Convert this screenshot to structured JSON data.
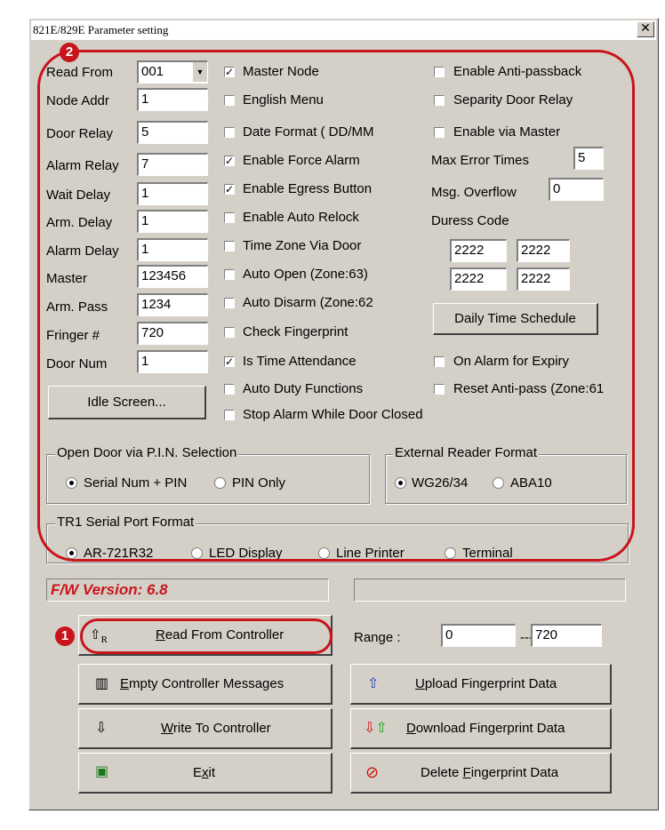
{
  "window": {
    "title": "821E/829E Parameter setting",
    "close_glyph": "✕"
  },
  "fields": [
    {
      "label": "Read From",
      "value": "001"
    },
    {
      "label": "Node Addr",
      "value": "1"
    },
    {
      "label": "Door Relay",
      "value": "5"
    },
    {
      "label": "Alarm Relay",
      "value": "7"
    },
    {
      "label": "Wait Delay",
      "value": "1"
    },
    {
      "label": "Arm. Delay",
      "value": "1"
    },
    {
      "label": "Alarm Delay",
      "value": "1"
    },
    {
      "label": "Master",
      "value": "123456"
    },
    {
      "label": "Arm. Pass",
      "value": "1234"
    },
    {
      "label": "Fringer #",
      "value": "720"
    },
    {
      "label": "Door Num",
      "value": "1"
    }
  ],
  "middle_checks": [
    {
      "label": "Master Node",
      "checked": true
    },
    {
      "label": "English Menu",
      "checked": false
    },
    {
      "label": "Date Format ( DD/MM",
      "checked": false
    },
    {
      "label": "Enable Force Alarm",
      "checked": true
    },
    {
      "label": "Enable Egress Button",
      "checked": true
    },
    {
      "label": "Enable Auto Relock",
      "checked": false
    },
    {
      "label": "Time Zone Via Door",
      "checked": false
    },
    {
      "label": "Auto Open (Zone:63)",
      "checked": false
    },
    {
      "label": "Auto Disarm (Zone:62",
      "checked": false
    },
    {
      "label": "Check Fingerprint",
      "checked": false
    },
    {
      "label": "Is Time Attendance",
      "checked": true
    },
    {
      "label": "Auto Duty Functions",
      "checked": false
    },
    {
      "label": "Stop Alarm While Door Closed",
      "checked": false
    }
  ],
  "right_checks": [
    {
      "label": "Enable Anti-passback",
      "checked": false
    },
    {
      "label": "Separity Door Relay",
      "checked": false
    },
    {
      "label": "Enable via Master",
      "checked": false
    }
  ],
  "max_error": {
    "label": "Max Error Times",
    "value": "5"
  },
  "msg_overflow": {
    "label": "Msg. Overflow",
    "value": "0"
  },
  "duress": {
    "label": "Duress Code",
    "codes": [
      "2222",
      "2222",
      "2222",
      "2222"
    ]
  },
  "daily_schedule_label": "Daily Time Schedule",
  "expiry_check": {
    "label": "On Alarm for Expiry",
    "checked": false
  },
  "reset_check": {
    "label": "Reset Anti-pass (Zone:61",
    "checked": false
  },
  "idle_button": "Idle Screen...",
  "pin_group": {
    "title": "Open Door via P.I.N. Selection",
    "options": [
      "Serial Num + PIN",
      "PIN Only"
    ],
    "selected": 0
  },
  "reader_group": {
    "title": "External Reader Format",
    "options": [
      "WG26/34",
      "ABA10"
    ],
    "selected": 0
  },
  "serial_group": {
    "title": "TR1 Serial Port Format",
    "options": [
      "AR-721R32",
      "LED Display",
      "Line Printer",
      "Terminal"
    ],
    "selected": 0
  },
  "fw_version": "F/W Version: 6.8",
  "range": {
    "label": "Range :",
    "from": "0",
    "sep": "---",
    "to": "720"
  },
  "buttons": {
    "read": {
      "pre": "",
      "ul": "R",
      "post": "ead From Controller"
    },
    "empty": {
      "pre": "",
      "ul": "E",
      "post": "mpty Controller Messages"
    },
    "write": {
      "pre": "",
      "ul": "W",
      "post": "rite To Controller"
    },
    "exit": {
      "pre": "E",
      "ul": "x",
      "post": "it"
    },
    "upload": {
      "pre": "",
      "ul": "U",
      "post": "pload Fingerprint Data"
    },
    "download": {
      "pre": "",
      "ul": "D",
      "post": "ownload Fingerprint Data"
    },
    "delete": {
      "pre": "Delete ",
      "ul": "F",
      "post": "ingerprint Data"
    }
  },
  "annotations": {
    "badge1": "1",
    "badge2": "2",
    "accent": "#c8151b"
  },
  "colors": {
    "dialog_bg": "#d4d0c8",
    "fw_text": "#c8151b"
  }
}
